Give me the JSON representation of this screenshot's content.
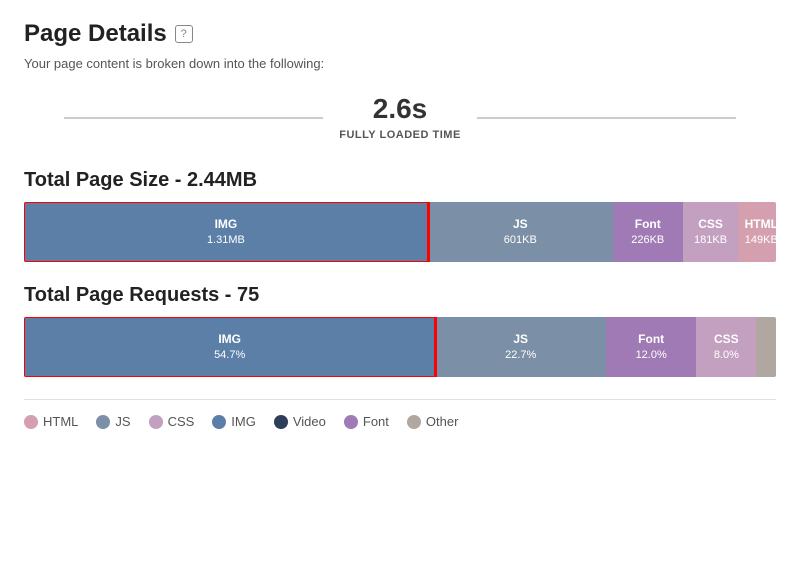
{
  "header": {
    "title": "Page Details",
    "help_label": "?",
    "subtitle": "Your page content is broken down into the following:"
  },
  "time": {
    "value": "2.6s",
    "label": "Fully Loaded Time"
  },
  "size_section": {
    "title": "Total Page Size - 2.44MB",
    "segments": [
      {
        "id": "img",
        "label": "IMG",
        "value": "1.31MB",
        "color_class": "color-img",
        "width_pct": 53.7,
        "selected": true
      },
      {
        "id": "js",
        "label": "JS",
        "value": "601KB",
        "color_class": "color-js",
        "width_pct": 24.6,
        "selected": false
      },
      {
        "id": "font",
        "label": "Font",
        "value": "226KB",
        "color_class": "color-font",
        "width_pct": 9.3,
        "selected": false
      },
      {
        "id": "css",
        "label": "CSS",
        "value": "181KB",
        "color_class": "color-css",
        "width_pct": 7.4,
        "selected": false
      },
      {
        "id": "html",
        "label": "HTML",
        "value": "149KB",
        "color_class": "color-html",
        "width_pct": 6.1,
        "selected": false
      }
    ]
  },
  "requests_section": {
    "title": "Total Page Requests - 75",
    "segments": [
      {
        "id": "img",
        "label": "IMG",
        "value": "54.7%",
        "color_class": "color-img",
        "width_pct": 54.7,
        "selected": true
      },
      {
        "id": "js",
        "label": "JS",
        "value": "22.7%",
        "color_class": "color-js",
        "width_pct": 22.7,
        "selected": false
      },
      {
        "id": "font",
        "label": "Font",
        "value": "12.0%",
        "color_class": "color-font",
        "width_pct": 12.0,
        "selected": false
      },
      {
        "id": "css",
        "label": "CSS",
        "value": "8.0%",
        "color_class": "color-css",
        "width_pct": 8.0,
        "selected": false
      },
      {
        "id": "other",
        "label": "",
        "value": "",
        "color_class": "color-other",
        "width_pct": 2.6,
        "selected": false
      }
    ]
  },
  "legend": {
    "items": [
      {
        "id": "html",
        "label": "HTML",
        "color_class": "color-html"
      },
      {
        "id": "js",
        "label": "JS",
        "color_class": "color-js"
      },
      {
        "id": "css",
        "label": "CSS",
        "color_class": "color-css"
      },
      {
        "id": "img",
        "label": "IMG",
        "color_class": "color-img"
      },
      {
        "id": "video",
        "label": "Video",
        "color_class": "color-video"
      },
      {
        "id": "font",
        "label": "Font",
        "color_class": "color-font"
      },
      {
        "id": "other",
        "label": "Other",
        "color_class": "color-other"
      }
    ]
  }
}
